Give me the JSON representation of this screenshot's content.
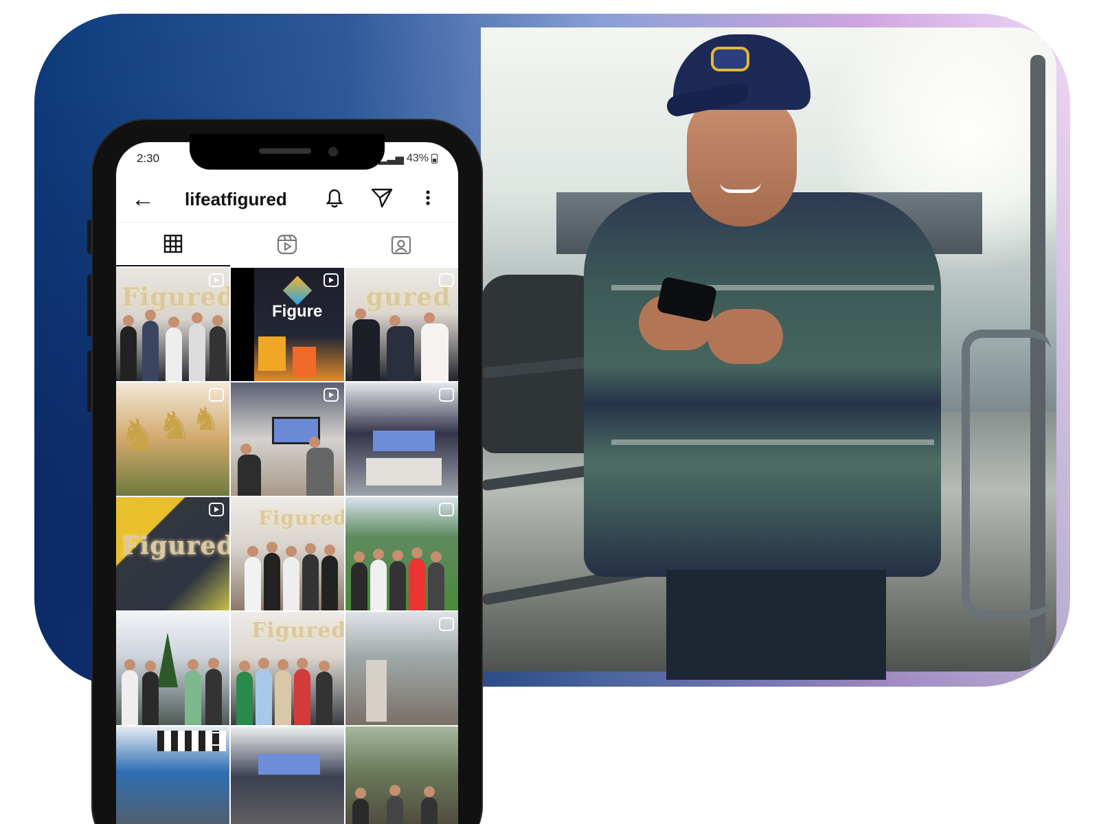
{
  "status_bar": {
    "time": "2:30",
    "battery": "43%"
  },
  "instagram": {
    "username": "lifeatfigured",
    "back_icon": "arrow-left-icon",
    "notifications_icon": "bell-icon",
    "direct_icon": "paper-plane-icon",
    "more_icon": "more-vertical-icon",
    "tabs": [
      {
        "name": "posts",
        "icon": "grid-icon",
        "active": true
      },
      {
        "name": "reels",
        "icon": "reels-icon",
        "active": false
      },
      {
        "name": "tagged",
        "icon": "tagged-icon",
        "active": false
      }
    ],
    "posts": [
      {
        "theme": "figured sign with team",
        "sign_text": "Figured",
        "badge": "reel"
      },
      {
        "theme": "figured logo wall",
        "logo_text": "Figure",
        "badge": "reel"
      },
      {
        "theme": "figured sign group",
        "sign_text": "gured",
        "badge": "multi"
      },
      {
        "theme": "gold deer trophies",
        "badge": "multi"
      },
      {
        "theme": "video call meeting",
        "badge": "reel"
      },
      {
        "theme": "conference room meeting",
        "badge": "multi"
      },
      {
        "theme": "figured sign office",
        "sign_text": "Figured",
        "badge": "reel"
      },
      {
        "theme": "figured sign group",
        "sign_text": "Figured",
        "badge": "none"
      },
      {
        "theme": "team on grass field",
        "badge": "multi"
      },
      {
        "theme": "christmas tree group",
        "badge": "none"
      },
      {
        "theme": "figured sign group",
        "sign_text": "Figured",
        "badge": "none"
      },
      {
        "theme": "team lunch",
        "badge": "multi"
      },
      {
        "theme": "outdoor cafe crowd",
        "badge": "multi"
      },
      {
        "theme": "meeting room",
        "badge": "none"
      },
      {
        "theme": "restaurant group",
        "badge": "none"
      }
    ]
  },
  "colors": {
    "card_gradient_start": "#0d3a7a",
    "card_gradient_end": "#eed8f4",
    "accent_gold": "#d9c9a3"
  }
}
